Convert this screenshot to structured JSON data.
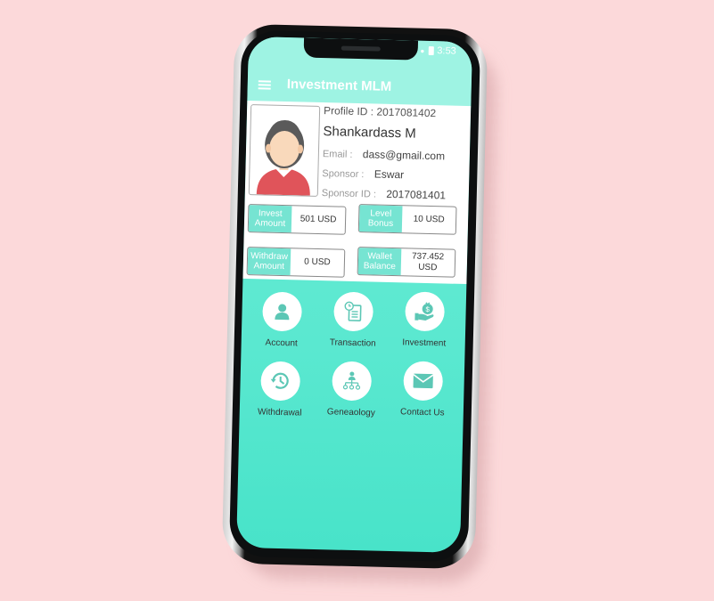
{
  "status_bar": {
    "time": "3:53"
  },
  "app_bar": {
    "title": "Investment MLM",
    "menu_icon": "hamburger-icon"
  },
  "profile": {
    "profile_id_label": "Profile ID :",
    "profile_id": "2017081402",
    "name": "Shankardass M",
    "email_label": "Email :",
    "email": "dass@gmail.com",
    "sponsor_label": "Sponsor :",
    "sponsor": "Eswar",
    "sponsor_id_label": "Sponsor ID :",
    "sponsor_id": "2017081401"
  },
  "stats": [
    {
      "label": "Invest Amount",
      "value": "501 USD"
    },
    {
      "label": "Level Bonus",
      "value": "10 USD"
    },
    {
      "label": "Withdraw Amount",
      "value": "0 USD"
    },
    {
      "label": "Wallet Balance",
      "value": "737.452 USD"
    }
  ],
  "menu": [
    {
      "label": "Account",
      "icon": "account-icon"
    },
    {
      "label": "Transaction",
      "icon": "transaction-icon"
    },
    {
      "label": "Investment",
      "icon": "investment-icon"
    },
    {
      "label": "Withdrawal",
      "icon": "withdrawal-icon"
    },
    {
      "label": "Geneaology",
      "icon": "genealogy-icon"
    },
    {
      "label": "Contact Us",
      "icon": "contact-icon"
    }
  ],
  "colors": {
    "accent": "#5ae8d0",
    "appbar": "#9ef3e3",
    "background": "#fcd9da",
    "stat_key": "#76e4d2"
  }
}
